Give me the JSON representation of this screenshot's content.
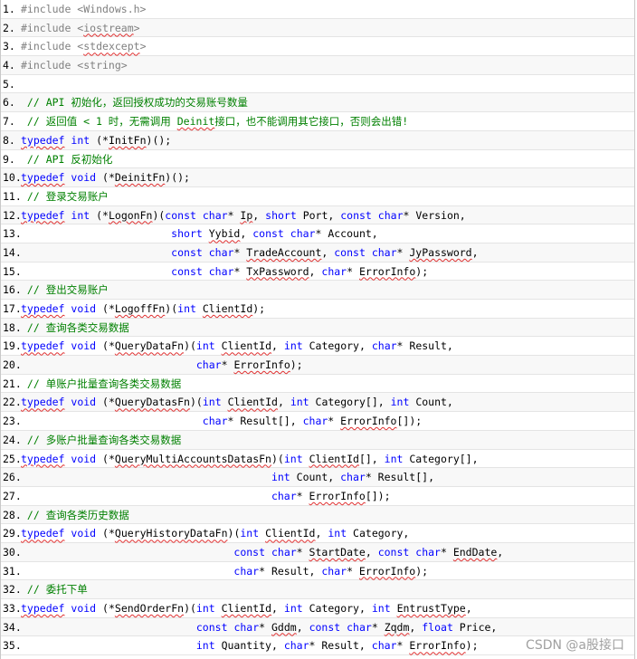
{
  "lines": [
    {
      "n": "1.",
      "segs": [
        {
          "t": "#include <Windows.h>",
          "c": "pp"
        }
      ]
    },
    {
      "n": "2.",
      "segs": [
        {
          "t": "#include <",
          "c": "pp"
        },
        {
          "t": "iostream",
          "c": "pp",
          "s": 1
        },
        {
          "t": ">",
          "c": "pp"
        }
      ]
    },
    {
      "n": "3.",
      "segs": [
        {
          "t": "#include <",
          "c": "pp"
        },
        {
          "t": "stdexcept",
          "c": "pp",
          "s": 1
        },
        {
          "t": ">",
          "c": "pp"
        }
      ]
    },
    {
      "n": "4.",
      "segs": [
        {
          "t": "#include <string>",
          "c": "pp"
        }
      ]
    },
    {
      "n": "5.",
      "segs": []
    },
    {
      "n": "6.",
      "segs": [
        {
          "t": " // API 初始化，返回授权成功的交易账号数量",
          "c": "cm"
        }
      ]
    },
    {
      "n": "7.",
      "segs": [
        {
          "t": " // 返回值 < 1 时，无需调用 ",
          "c": "cm"
        },
        {
          "t": "Deinit",
          "c": "cm",
          "s": 1
        },
        {
          "t": "接口，也不能调用其它接口，否则会出错!",
          "c": "cm"
        }
      ]
    },
    {
      "n": "8.",
      "segs": [
        {
          "t": "typedef",
          "c": "kw",
          "s": 1
        },
        {
          "t": " ",
          "c": "pl"
        },
        {
          "t": "int",
          "c": "kw"
        },
        {
          "t": " (*",
          "c": "pl"
        },
        {
          "t": "InitFn",
          "c": "pl",
          "s": 1
        },
        {
          "t": ")();",
          "c": "pl"
        }
      ]
    },
    {
      "n": "9.",
      "segs": [
        {
          "t": " // API 反初始化",
          "c": "cm"
        }
      ]
    },
    {
      "n": "10.",
      "segs": [
        {
          "t": "typedef",
          "c": "kw",
          "s": 1
        },
        {
          "t": " ",
          "c": "pl"
        },
        {
          "t": "void",
          "c": "kw"
        },
        {
          "t": " (*",
          "c": "pl"
        },
        {
          "t": "DeinitFn",
          "c": "pl",
          "s": 1
        },
        {
          "t": ")();",
          "c": "pl"
        }
      ]
    },
    {
      "n": "11.",
      "segs": [
        {
          "t": " // 登录交易账户",
          "c": "cm"
        }
      ]
    },
    {
      "n": "12.",
      "segs": [
        {
          "t": "typedef",
          "c": "kw",
          "s": 1
        },
        {
          "t": " ",
          "c": "pl"
        },
        {
          "t": "int",
          "c": "kw"
        },
        {
          "t": " (*",
          "c": "pl"
        },
        {
          "t": "LogonFn",
          "c": "pl",
          "s": 1
        },
        {
          "t": ")(",
          "c": "pl"
        },
        {
          "t": "const",
          "c": "kw"
        },
        {
          "t": " ",
          "c": "pl"
        },
        {
          "t": "char",
          "c": "kw"
        },
        {
          "t": "* ",
          "c": "pl"
        },
        {
          "t": "Ip",
          "c": "pl",
          "s": 1
        },
        {
          "t": ", ",
          "c": "pl"
        },
        {
          "t": "short",
          "c": "kw"
        },
        {
          "t": " Port, ",
          "c": "pl"
        },
        {
          "t": "const",
          "c": "kw"
        },
        {
          "t": " ",
          "c": "pl"
        },
        {
          "t": "char",
          "c": "kw"
        },
        {
          "t": "* Version,",
          "c": "pl"
        }
      ]
    },
    {
      "n": "13.",
      "segs": [
        {
          "t": "                        ",
          "c": "pl"
        },
        {
          "t": "short",
          "c": "kw"
        },
        {
          "t": " ",
          "c": "pl"
        },
        {
          "t": "Yybid",
          "c": "pl",
          "s": 1
        },
        {
          "t": ", ",
          "c": "pl"
        },
        {
          "t": "const",
          "c": "kw"
        },
        {
          "t": " ",
          "c": "pl"
        },
        {
          "t": "char",
          "c": "kw"
        },
        {
          "t": "* Account,",
          "c": "pl"
        }
      ]
    },
    {
      "n": "14.",
      "segs": [
        {
          "t": "                        ",
          "c": "pl"
        },
        {
          "t": "const",
          "c": "kw"
        },
        {
          "t": " ",
          "c": "pl"
        },
        {
          "t": "char",
          "c": "kw"
        },
        {
          "t": "* ",
          "c": "pl"
        },
        {
          "t": "TradeAccount",
          "c": "pl",
          "s": 1
        },
        {
          "t": ", ",
          "c": "pl"
        },
        {
          "t": "const",
          "c": "kw"
        },
        {
          "t": " ",
          "c": "pl"
        },
        {
          "t": "char",
          "c": "kw"
        },
        {
          "t": "* ",
          "c": "pl"
        },
        {
          "t": "JyPassword",
          "c": "pl",
          "s": 1
        },
        {
          "t": ",",
          "c": "pl"
        }
      ]
    },
    {
      "n": "15.",
      "segs": [
        {
          "t": "                        ",
          "c": "pl"
        },
        {
          "t": "const",
          "c": "kw"
        },
        {
          "t": " ",
          "c": "pl"
        },
        {
          "t": "char",
          "c": "kw"
        },
        {
          "t": "* ",
          "c": "pl"
        },
        {
          "t": "TxPassword",
          "c": "pl",
          "s": 1
        },
        {
          "t": ", ",
          "c": "pl"
        },
        {
          "t": "char",
          "c": "kw"
        },
        {
          "t": "* ",
          "c": "pl"
        },
        {
          "t": "ErrorInfo",
          "c": "pl",
          "s": 1
        },
        {
          "t": ");",
          "c": "pl"
        }
      ]
    },
    {
      "n": "16.",
      "segs": [
        {
          "t": " // 登出交易账户",
          "c": "cm"
        }
      ]
    },
    {
      "n": "17.",
      "segs": [
        {
          "t": "typedef",
          "c": "kw",
          "s": 1
        },
        {
          "t": " ",
          "c": "pl"
        },
        {
          "t": "void",
          "c": "kw"
        },
        {
          "t": " (*",
          "c": "pl"
        },
        {
          "t": "LogoffFn",
          "c": "pl",
          "s": 1
        },
        {
          "t": ")(",
          "c": "pl"
        },
        {
          "t": "int",
          "c": "kw"
        },
        {
          "t": " ",
          "c": "pl"
        },
        {
          "t": "ClientId",
          "c": "pl",
          "s": 1
        },
        {
          "t": ");",
          "c": "pl"
        }
      ]
    },
    {
      "n": "18.",
      "segs": [
        {
          "t": " // 查询各类交易数据",
          "c": "cm"
        }
      ]
    },
    {
      "n": "19.",
      "segs": [
        {
          "t": "typedef",
          "c": "kw",
          "s": 1
        },
        {
          "t": " ",
          "c": "pl"
        },
        {
          "t": "void",
          "c": "kw"
        },
        {
          "t": " (*",
          "c": "pl"
        },
        {
          "t": "QueryDataFn",
          "c": "pl",
          "s": 1
        },
        {
          "t": ")(",
          "c": "pl"
        },
        {
          "t": "int",
          "c": "kw"
        },
        {
          "t": " ",
          "c": "pl"
        },
        {
          "t": "ClientId",
          "c": "pl",
          "s": 1
        },
        {
          "t": ", ",
          "c": "pl"
        },
        {
          "t": "int",
          "c": "kw"
        },
        {
          "t": " Category, ",
          "c": "pl"
        },
        {
          "t": "char",
          "c": "kw"
        },
        {
          "t": "* Result,",
          "c": "pl"
        }
      ]
    },
    {
      "n": "20.",
      "segs": [
        {
          "t": "                            ",
          "c": "pl"
        },
        {
          "t": "char",
          "c": "kw"
        },
        {
          "t": "* ",
          "c": "pl"
        },
        {
          "t": "ErrorInfo",
          "c": "pl",
          "s": 1
        },
        {
          "t": ");",
          "c": "pl"
        }
      ]
    },
    {
      "n": "21.",
      "segs": [
        {
          "t": " // 单账户批量查询各类交易数据",
          "c": "cm"
        }
      ]
    },
    {
      "n": "22.",
      "segs": [
        {
          "t": "typedef",
          "c": "kw",
          "s": 1
        },
        {
          "t": " ",
          "c": "pl"
        },
        {
          "t": "void",
          "c": "kw"
        },
        {
          "t": " (*",
          "c": "pl"
        },
        {
          "t": "QueryDatasFn",
          "c": "pl",
          "s": 1
        },
        {
          "t": ")(",
          "c": "pl"
        },
        {
          "t": "int",
          "c": "kw"
        },
        {
          "t": " ",
          "c": "pl"
        },
        {
          "t": "ClientId",
          "c": "pl",
          "s": 1
        },
        {
          "t": ", ",
          "c": "pl"
        },
        {
          "t": "int",
          "c": "kw"
        },
        {
          "t": " Category[], ",
          "c": "pl"
        },
        {
          "t": "int",
          "c": "kw"
        },
        {
          "t": " Count,",
          "c": "pl"
        }
      ]
    },
    {
      "n": "23.",
      "segs": [
        {
          "t": "                             ",
          "c": "pl"
        },
        {
          "t": "char",
          "c": "kw"
        },
        {
          "t": "* Result[], ",
          "c": "pl"
        },
        {
          "t": "char",
          "c": "kw"
        },
        {
          "t": "* ",
          "c": "pl"
        },
        {
          "t": "ErrorInfo",
          "c": "pl",
          "s": 1
        },
        {
          "t": "[]);",
          "c": "pl"
        }
      ]
    },
    {
      "n": "24.",
      "segs": [
        {
          "t": " // 多账户批量查询各类交易数据",
          "c": "cm"
        }
      ]
    },
    {
      "n": "25.",
      "segs": [
        {
          "t": "typedef",
          "c": "kw",
          "s": 1
        },
        {
          "t": " ",
          "c": "pl"
        },
        {
          "t": "void",
          "c": "kw"
        },
        {
          "t": " (*",
          "c": "pl"
        },
        {
          "t": "QueryMultiAccountsDatasFn",
          "c": "pl",
          "s": 1
        },
        {
          "t": ")(",
          "c": "pl"
        },
        {
          "t": "int",
          "c": "kw"
        },
        {
          "t": " ",
          "c": "pl"
        },
        {
          "t": "ClientId",
          "c": "pl",
          "s": 1
        },
        {
          "t": "[], ",
          "c": "pl"
        },
        {
          "t": "int",
          "c": "kw"
        },
        {
          "t": " Category[],",
          "c": "pl"
        }
      ]
    },
    {
      "n": "26.",
      "segs": [
        {
          "t": "                                        ",
          "c": "pl"
        },
        {
          "t": "int",
          "c": "kw"
        },
        {
          "t": " Count, ",
          "c": "pl"
        },
        {
          "t": "char",
          "c": "kw"
        },
        {
          "t": "* Result[],",
          "c": "pl"
        }
      ]
    },
    {
      "n": "27.",
      "segs": [
        {
          "t": "                                        ",
          "c": "pl"
        },
        {
          "t": "char",
          "c": "kw"
        },
        {
          "t": "* ",
          "c": "pl"
        },
        {
          "t": "ErrorInfo",
          "c": "pl",
          "s": 1
        },
        {
          "t": "[]);",
          "c": "pl"
        }
      ]
    },
    {
      "n": "28.",
      "segs": [
        {
          "t": " // 查询各类历史数据",
          "c": "cm"
        }
      ]
    },
    {
      "n": "29.",
      "segs": [
        {
          "t": "typedef",
          "c": "kw",
          "s": 1
        },
        {
          "t": " ",
          "c": "pl"
        },
        {
          "t": "void",
          "c": "kw"
        },
        {
          "t": " (*",
          "c": "pl"
        },
        {
          "t": "QueryHistoryDataFn",
          "c": "pl",
          "s": 1
        },
        {
          "t": ")(",
          "c": "pl"
        },
        {
          "t": "int",
          "c": "kw"
        },
        {
          "t": " ",
          "c": "pl"
        },
        {
          "t": "ClientId",
          "c": "pl",
          "s": 1
        },
        {
          "t": ", ",
          "c": "pl"
        },
        {
          "t": "int",
          "c": "kw"
        },
        {
          "t": " Category,",
          "c": "pl"
        }
      ]
    },
    {
      "n": "30.",
      "segs": [
        {
          "t": "                                  ",
          "c": "pl"
        },
        {
          "t": "const",
          "c": "kw"
        },
        {
          "t": " ",
          "c": "pl"
        },
        {
          "t": "char",
          "c": "kw"
        },
        {
          "t": "* ",
          "c": "pl"
        },
        {
          "t": "StartDate",
          "c": "pl",
          "s": 1
        },
        {
          "t": ", ",
          "c": "pl"
        },
        {
          "t": "const",
          "c": "kw"
        },
        {
          "t": " ",
          "c": "pl"
        },
        {
          "t": "char",
          "c": "kw"
        },
        {
          "t": "* ",
          "c": "pl"
        },
        {
          "t": "EndDate",
          "c": "pl",
          "s": 1
        },
        {
          "t": ",",
          "c": "pl"
        }
      ]
    },
    {
      "n": "31.",
      "segs": [
        {
          "t": "                                  ",
          "c": "pl"
        },
        {
          "t": "char",
          "c": "kw"
        },
        {
          "t": "* Result, ",
          "c": "pl"
        },
        {
          "t": "char",
          "c": "kw"
        },
        {
          "t": "* ",
          "c": "pl"
        },
        {
          "t": "ErrorInfo",
          "c": "pl",
          "s": 1
        },
        {
          "t": ");",
          "c": "pl"
        }
      ]
    },
    {
      "n": "32.",
      "segs": [
        {
          "t": " // 委托下单",
          "c": "cm"
        }
      ]
    },
    {
      "n": "33.",
      "segs": [
        {
          "t": "typedef",
          "c": "kw",
          "s": 1
        },
        {
          "t": " ",
          "c": "pl"
        },
        {
          "t": "void",
          "c": "kw"
        },
        {
          "t": " (*",
          "c": "pl"
        },
        {
          "t": "SendOrderFn",
          "c": "pl",
          "s": 1
        },
        {
          "t": ")(",
          "c": "pl"
        },
        {
          "t": "int",
          "c": "kw"
        },
        {
          "t": " ",
          "c": "pl"
        },
        {
          "t": "ClientId",
          "c": "pl",
          "s": 1
        },
        {
          "t": ", ",
          "c": "pl"
        },
        {
          "t": "int",
          "c": "kw"
        },
        {
          "t": " Category, ",
          "c": "pl"
        },
        {
          "t": "int",
          "c": "kw"
        },
        {
          "t": " ",
          "c": "pl"
        },
        {
          "t": "EntrustType",
          "c": "pl",
          "s": 1
        },
        {
          "t": ",",
          "c": "pl"
        }
      ]
    },
    {
      "n": "34.",
      "segs": [
        {
          "t": "                            ",
          "c": "pl"
        },
        {
          "t": "const",
          "c": "kw"
        },
        {
          "t": " ",
          "c": "pl"
        },
        {
          "t": "char",
          "c": "kw"
        },
        {
          "t": "* ",
          "c": "pl"
        },
        {
          "t": "Gddm",
          "c": "pl",
          "s": 1
        },
        {
          "t": ", ",
          "c": "pl"
        },
        {
          "t": "const",
          "c": "kw"
        },
        {
          "t": " ",
          "c": "pl"
        },
        {
          "t": "char",
          "c": "kw"
        },
        {
          "t": "* ",
          "c": "pl"
        },
        {
          "t": "Zqdm",
          "c": "pl",
          "s": 1
        },
        {
          "t": ", ",
          "c": "pl"
        },
        {
          "t": "float",
          "c": "kw"
        },
        {
          "t": " Price,",
          "c": "pl"
        }
      ]
    },
    {
      "n": "35.",
      "segs": [
        {
          "t": "                            ",
          "c": "pl"
        },
        {
          "t": "int",
          "c": "kw"
        },
        {
          "t": " Quantity, ",
          "c": "pl"
        },
        {
          "t": "char",
          "c": "kw"
        },
        {
          "t": "* Result, ",
          "c": "pl"
        },
        {
          "t": "char",
          "c": "kw"
        },
        {
          "t": "* ",
          "c": "pl"
        },
        {
          "t": "ErrorInfo",
          "c": "pl",
          "s": 1
        },
        {
          "t": ");",
          "c": "pl"
        }
      ]
    }
  ],
  "watermark": "CSDN @a股接口"
}
